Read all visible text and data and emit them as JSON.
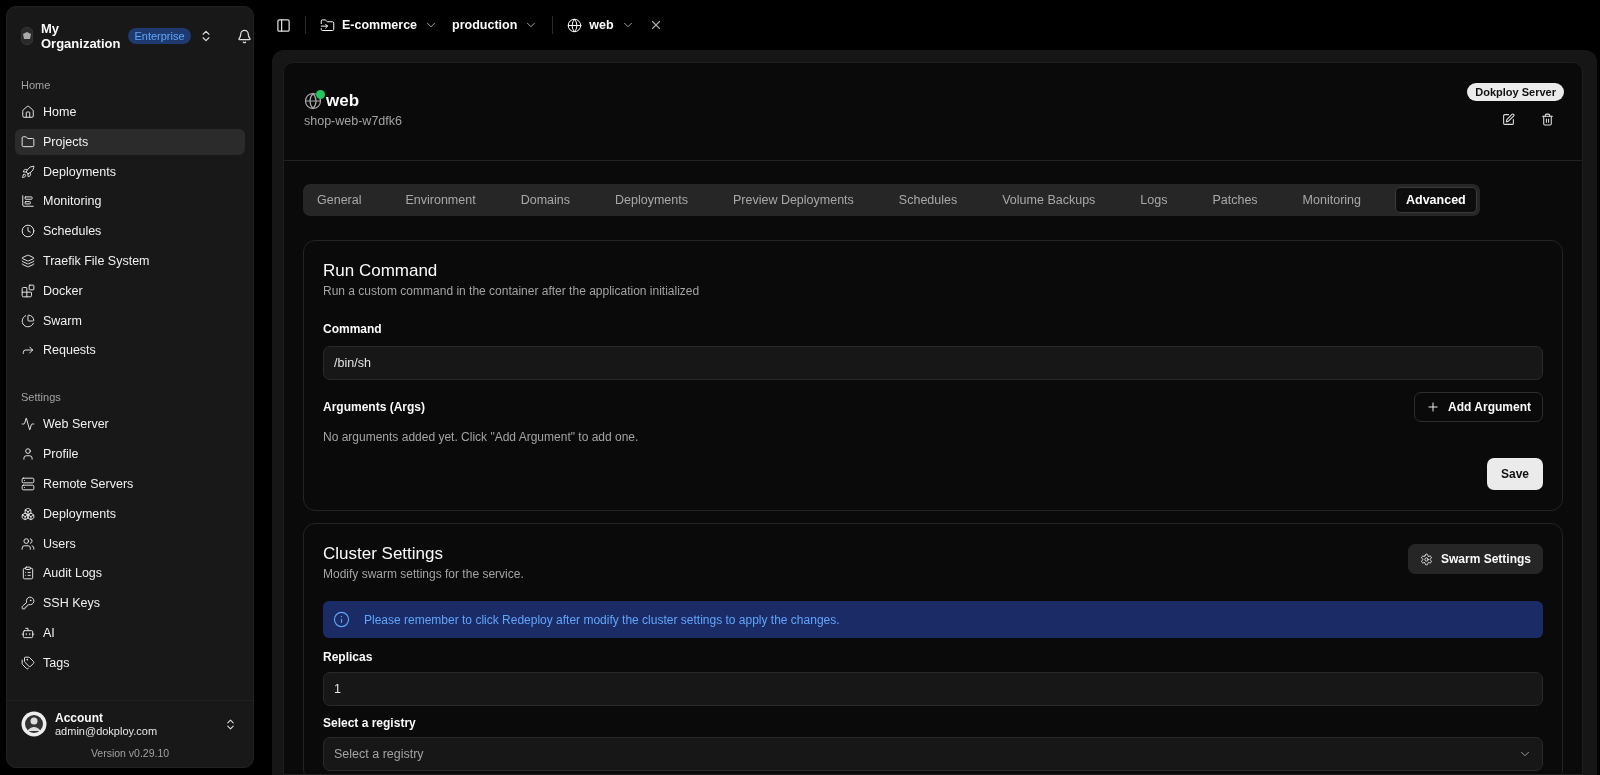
{
  "org": {
    "name": "My Organization",
    "badge": "Enterprise"
  },
  "sidebar": {
    "sections": [
      {
        "title": "Home",
        "items": [
          {
            "label": "Home",
            "selected": false
          },
          {
            "label": "Projects",
            "selected": true
          },
          {
            "label": "Deployments",
            "selected": false
          },
          {
            "label": "Monitoring",
            "selected": false
          },
          {
            "label": "Schedules",
            "selected": false
          },
          {
            "label": "Traefik File System",
            "selected": false
          },
          {
            "label": "Docker",
            "selected": false
          },
          {
            "label": "Swarm",
            "selected": false
          },
          {
            "label": "Requests",
            "selected": false
          }
        ]
      },
      {
        "title": "Settings",
        "items": [
          {
            "label": "Web Server",
            "selected": false
          },
          {
            "label": "Profile",
            "selected": false
          },
          {
            "label": "Remote Servers",
            "selected": false
          },
          {
            "label": "Deployments",
            "selected": false
          },
          {
            "label": "Users",
            "selected": false
          },
          {
            "label": "Audit Logs",
            "selected": false
          },
          {
            "label": "SSH Keys",
            "selected": false
          },
          {
            "label": "AI",
            "selected": false
          },
          {
            "label": "Tags",
            "selected": false
          }
        ]
      }
    ]
  },
  "account": {
    "name": "Account",
    "email": "admin@dokploy.com",
    "version": "Version v0.29.10"
  },
  "breadcrumbs": [
    {
      "kind": "project",
      "label": "E-commerce"
    },
    {
      "kind": "environment",
      "label": "production"
    },
    {
      "kind": "service",
      "label": "web"
    }
  ],
  "service": {
    "name": "web",
    "running": true,
    "slug": "shop-web-w7dfk6",
    "server_badge": "Dokploy Server"
  },
  "tabs": [
    {
      "label": "General",
      "selected": false
    },
    {
      "label": "Environment",
      "selected": false
    },
    {
      "label": "Domains",
      "selected": false
    },
    {
      "label": "Deployments",
      "selected": false
    },
    {
      "label": "Preview Deployments",
      "selected": false
    },
    {
      "label": "Schedules",
      "selected": false
    },
    {
      "label": "Volume Backups",
      "selected": false
    },
    {
      "label": "Logs",
      "selected": false
    },
    {
      "label": "Patches",
      "selected": false
    },
    {
      "label": "Monitoring",
      "selected": false
    },
    {
      "label": "Advanced",
      "selected": true
    }
  ],
  "run_command": {
    "title": "Run Command",
    "description": "Run a custom command in the container after the application initialized",
    "command_label": "Command",
    "command_value": "/bin/sh",
    "args_label": "Arguments (Args)",
    "add_button": "Add Argument",
    "empty_text": "No arguments added yet. Click \"Add Argument\" to add one.",
    "save_button": "Save"
  },
  "cluster": {
    "title": "Cluster Settings",
    "description": "Modify swarm settings for the service.",
    "swarm_button": "Swarm Settings",
    "alert": "Please remember to click Redeploy after modify the cluster settings to apply the changes.",
    "replicas_label": "Replicas",
    "replicas_value": "1",
    "registry_label": "Select a registry",
    "registry_placeholder": "Select a registry"
  }
}
